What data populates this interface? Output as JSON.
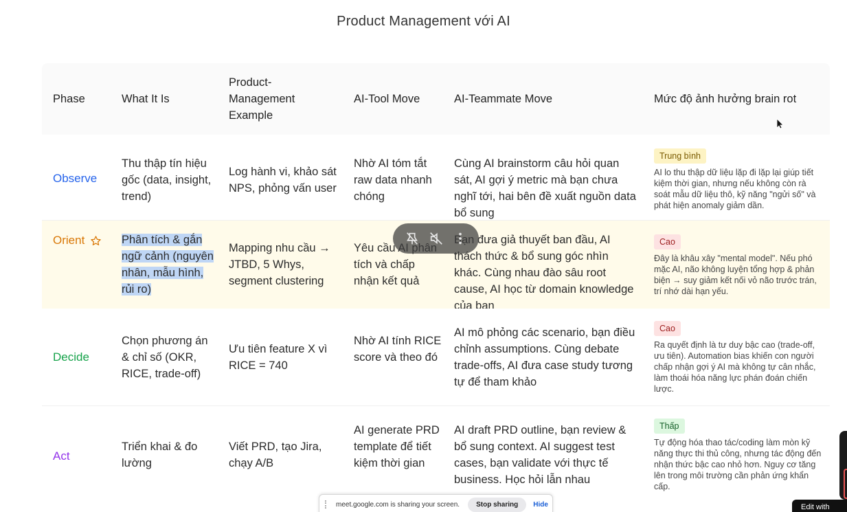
{
  "page": {
    "title": "Product Management với AI"
  },
  "table": {
    "headers": [
      "Phase",
      "What It Is",
      "Product-\nManagement\nExample",
      "AI-Tool Move",
      "AI-Teammate Move",
      "Mức độ ảnh hưởng brain rot"
    ],
    "rows": [
      {
        "phase": "Observe",
        "what": "Thu thập tín hiệu gốc (data, insight, trend)",
        "example": "Log hành vi, khảo sát NPS, phỏng vấn user",
        "tool": "Nhờ AI tóm tắt raw data nhanh chóng",
        "teammate": "Cùng AI brainstorm câu hỏi quan sát, AI gợi ý metric mà bạn chưa nghĩ tới, hai bên đề xuất nguồn data bổ sung",
        "level": "Trung bình",
        "note": "AI lo thu thập dữ liệu lặp đi lặp lại giúp tiết kiệm thời gian, nhưng nếu không còn rà soát mẫu dữ liệu thô, kỹ năng \"ngửi số\" và phát hiện anomaly giảm dần."
      },
      {
        "phase": "Orient",
        "what": "Phân tích & gắn ngữ cảnh (nguyên nhân, mẫu hình, rủi ro)",
        "example": "Mapping nhu cầu → JTBD, 5 Whys, segment clustering",
        "tool": "Yêu cầu AI phân tích và chấp nhận kết quả",
        "teammate": "Bạn đưa giả thuyết ban đầu, AI thách thức & bổ sung góc nhìn khác. Cùng nhau đào sâu root cause, AI học từ domain knowledge của bạn",
        "level": "Cao",
        "note": "Đây là khâu xây \"mental model\". Nếu phó mặc AI, não không luyện tổng hợp & phản biện → suy giảm kết nối vỏ não trước trán, trí nhớ dài hạn yếu."
      },
      {
        "phase": "Decide",
        "what": "Chọn phương án & chỉ số (OKR, RICE, trade-off)",
        "example": "Ưu tiên feature X vì RICE = 740",
        "tool": "Nhờ AI tính RICE score và theo đó",
        "teammate": "AI mô phỏng các scenario, bạn điều chỉnh assumptions. Cùng debate trade-offs, AI đưa case study tương tự để tham khảo",
        "level": "Cao",
        "note": "Ra quyết định là tư duy bậc cao (trade-off, ưu tiên). Automation bias khiến con người chấp nhận gợi ý AI mà không tự cân nhắc, làm thoái hóa năng lực phán đoán chiến lược."
      },
      {
        "phase": "Act",
        "what": "Triển khai & đo lường",
        "example": "Viết PRD, tạo Jira, chạy A/B",
        "tool": "AI generate PRD template để tiết kiệm thời gian",
        "teammate": "AI draft PRD outline, bạn review & bổ sung context. AI suggest test cases, bạn validate với thực tế business. Học hỏi lẫn nhau",
        "level": "Thấp",
        "note": "Tự động hóa thao tác/coding làm mòn kỹ năng thực thi thủ công, nhưng tác động đến nhận thức bậc cao nhỏ hơn. Nguy cơ tăng lên trong môi trường cần phản ứng khẩn cấp."
      }
    ]
  },
  "share_bar": {
    "message": "meet.google.com is sharing your screen.",
    "stop_label": "Stop sharing",
    "hide_label": "Hide"
  },
  "edit_with": {
    "label": "Edit with"
  },
  "colors": {
    "observe": "#2563eb",
    "orient": "#d97706",
    "decide": "#16a34a",
    "act": "#9333ea",
    "orient_row_bg": "#fffbea"
  }
}
